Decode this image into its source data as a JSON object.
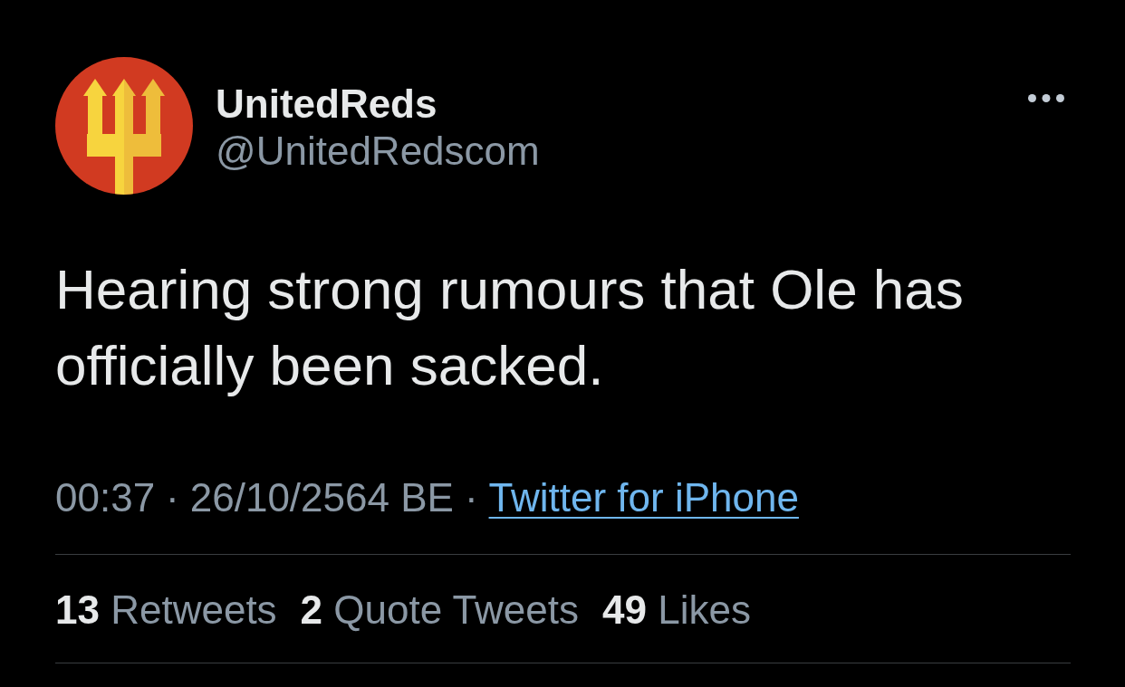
{
  "author": {
    "display_name": "UnitedReds",
    "handle": "@UnitedRedscom"
  },
  "tweet": {
    "text": "Hearing strong rumours that Ole has officially been sacked."
  },
  "meta": [
    {
      "kind": "time",
      "text": "00:37"
    },
    {
      "kind": "separator",
      "text": "·"
    },
    {
      "kind": "date",
      "text": "26/10/2564 BE"
    },
    {
      "kind": "separator",
      "text": "·"
    },
    {
      "kind": "link",
      "text": "Twitter for iPhone"
    }
  ],
  "stats": [
    {
      "count": "13",
      "label": "Retweets"
    },
    {
      "count": "2",
      "label": "Quote Tweets"
    },
    {
      "count": "49",
      "label": "Likes"
    }
  ]
}
